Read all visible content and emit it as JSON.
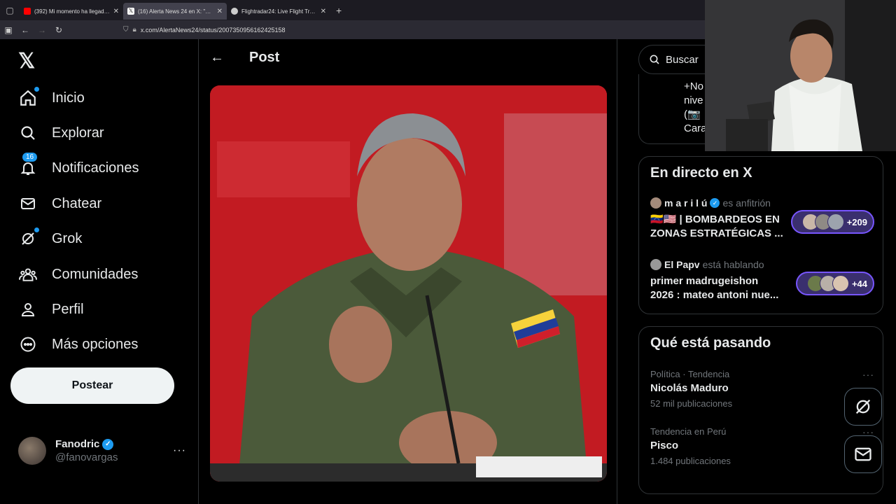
{
  "browser": {
    "tabs": [
      {
        "title": "(392) Mi momento ha llegado (",
        "favicon_color": "#ff0000",
        "active": false
      },
      {
        "title": "(16) Alerta News 24 en X: \"🇻🇪 | E",
        "favicon_color": "#ffffff",
        "active": true
      },
      {
        "title": "Flightradar24: Live Flight Tracke",
        "favicon_color": "#cccccc",
        "active": false
      }
    ],
    "url": "x.com/AlertaNews24/status/2007350956162425158"
  },
  "sidebar": {
    "logo": "𝕏",
    "items": [
      {
        "label": "Inicio",
        "icon": "home-icon",
        "dot": true
      },
      {
        "label": "Explorar",
        "icon": "search-icon"
      },
      {
        "label": "Notificaciones",
        "icon": "bell-icon",
        "badge": "16"
      },
      {
        "label": "Chatear",
        "icon": "mail-icon"
      },
      {
        "label": "Grok",
        "icon": "grok-icon",
        "dot": true
      },
      {
        "label": "Comunidades",
        "icon": "people-icon"
      },
      {
        "label": "Perfil",
        "icon": "person-icon"
      },
      {
        "label": "Más opciones",
        "icon": "more-circle-icon"
      }
    ],
    "post_button": "Postear",
    "profile": {
      "name": "Fanodric",
      "handle": "@fanovargas",
      "more": "···"
    }
  },
  "main": {
    "title": "Post",
    "back_icon": "←"
  },
  "right": {
    "search_placeholder": "Buscar",
    "prev_card_lines": [
      "+No",
      "nive",
      "(📷",
      "Cara"
    ],
    "live": {
      "title": "En directo en X",
      "items": [
        {
          "host": "m a r i l ú",
          "host_suffix": "es anfitrión",
          "verified": true,
          "title": "🇻🇪🇺🇸 | BOMBARDEOS EN ZONAS ESTRATÉGICAS ...",
          "listeners": "+209"
        },
        {
          "host": "El Papv",
          "host_suffix": "está hablando",
          "verified": false,
          "title": "primer madrugeishon 2026 : mateo antoni nue...",
          "listeners": "+44"
        }
      ]
    },
    "trends": {
      "title": "Qué está pasando",
      "items": [
        {
          "meta": "Política · Tendencia",
          "name": "Nicolás Maduro",
          "count": "52 mil publicaciones"
        },
        {
          "meta": "Tendencia en Perú",
          "name": "Pisco",
          "count": "1.484 publicaciones"
        }
      ],
      "more": "···"
    }
  },
  "colors": {
    "accent": "#1d9bf0",
    "spaces": "#7856ff"
  }
}
